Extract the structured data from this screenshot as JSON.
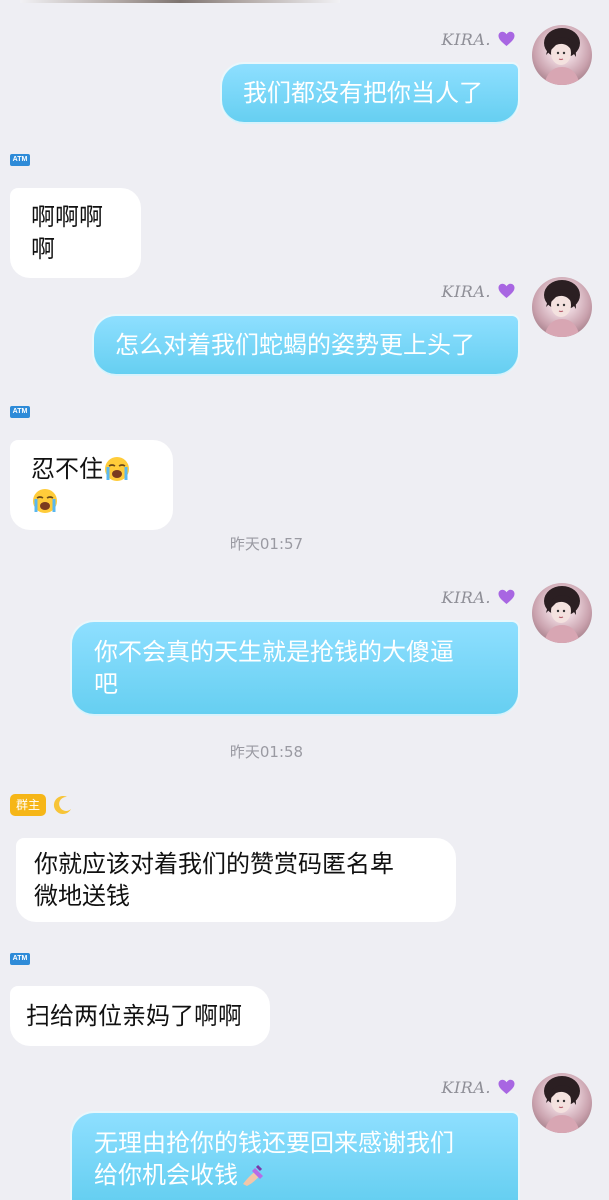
{
  "sender_name": "KIRA.",
  "atm_label": "ATM",
  "admin_badge": "群主",
  "timestamps": [
    "昨天01:57",
    "昨天01:58"
  ],
  "messages": [
    {
      "side": "right",
      "text": "我们都没有把你当人了"
    },
    {
      "side": "left",
      "text": "啊啊啊啊"
    },
    {
      "side": "right",
      "text": "怎么对着我们蛇蝎的姿势更上头了"
    },
    {
      "side": "left",
      "text": "忍不住"
    },
    {
      "side": "right",
      "line1": "你不会真的天生就是抢钱的大傻逼",
      "line2": "吧"
    },
    {
      "side": "left",
      "line1": "你就应该对着我们的赞赏码匿名卑",
      "line2": "微地送钱"
    },
    {
      "side": "left",
      "text": "扫给两位亲妈了啊啊"
    },
    {
      "side": "right",
      "line1": "无理由抢你的钱还要回来感谢我们",
      "line2": "给你机会收钱"
    }
  ],
  "icons": [
    "purple-heart-icon",
    "loudly-crying-face-icon",
    "crescent-moon-icon",
    "nail-polish-icon"
  ],
  "colors": {
    "background": "#eeeef3",
    "right_bubble": "#7fd8f7",
    "left_bubble": "#ffffff",
    "admin_badge": "#f6b617"
  }
}
